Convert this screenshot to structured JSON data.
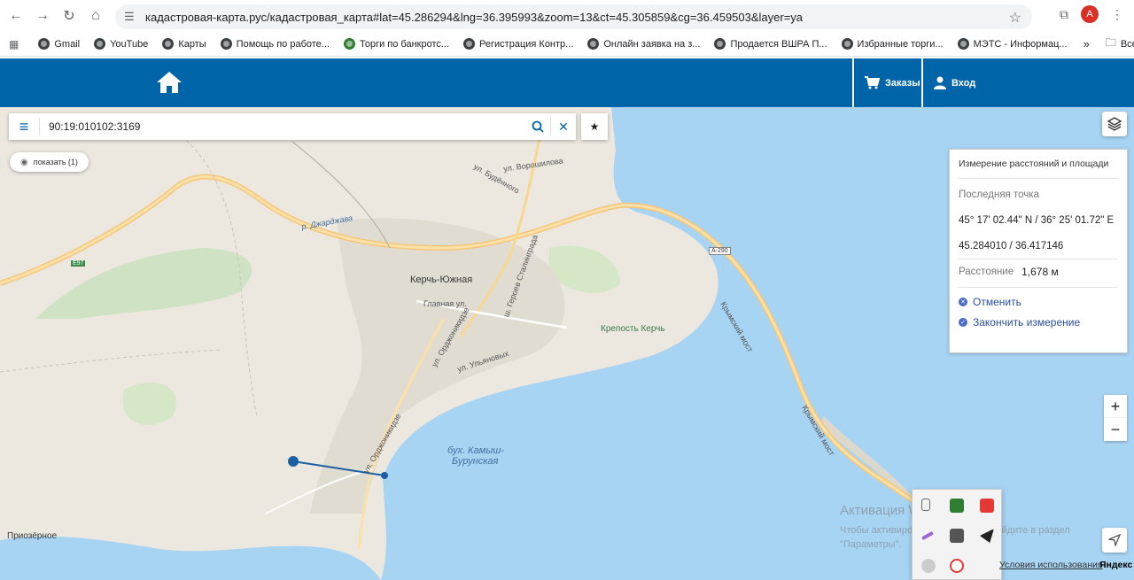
{
  "browser": {
    "url": "кадастровая-карта.рус/кадастровая_карта#lat=45.286294&lng=36.395993&zoom=13&ct=45.305859&cg=36.459503&layer=ya",
    "avatar_letter": "A",
    "bookmarks": [
      "Gmail",
      "YouTube",
      "Карты",
      "Помощь по работе...",
      "Торги по банкротс...",
      "Регистрация Контр...",
      "Онлайн заявка на з...",
      "Продается ВШРА П...",
      "Избранные торги...",
      "МЭТС - Информац..."
    ],
    "more_label": "»",
    "all_bookmarks": "Все закладки"
  },
  "header": {
    "orders_label": "Заказы",
    "login_label": "Вход",
    "color": "#0065a8"
  },
  "search": {
    "value": "90:19:010102:3169"
  },
  "show_button": "показать (1)",
  "measure_panel": {
    "title": "Измерение расстояний и площади",
    "last_point_label": "Последняя точка",
    "dms": "45° 17' 02.44\" N / 36° 25' 01.72\" E",
    "decimal": "45.284010 / 36.417146",
    "distance_label": "Расстояние",
    "distance_value": "1,678 м",
    "cancel_label": "Отменить",
    "finish_label": "Закончить измерение"
  },
  "zoom": {
    "in": "+",
    "out": "−"
  },
  "map_labels": {
    "kerch_south": "Керчь-Южная",
    "fortress": "Крепость Керчь",
    "bay": "бух. Камыш-",
    "bay2": "Бурунская",
    "prioz": "Приозёрное",
    "road_e97": "E97",
    "road_a290": "A-290",
    "crimean_bridge": "Крымский мост",
    "crimean_bridge2": "Крымский мост",
    "river": "р. Джарджава",
    "main_st": "Главная ул.",
    "ord_st": "ул. Орджоникидзе",
    "ord_st2": "ул. Орджоникидзе",
    "ulyan_st": "ул. Ульяновых",
    "voroshilov": "ул. Ворошилова",
    "budenny": "ул. Будённого",
    "heroes": "ш. Героев Сталинграда"
  },
  "watermark": {
    "line1": "Активация Windows",
    "line2": "Чтобы активировать Windows, перейдите в раздел",
    "line3": "\"Параметры\"."
  },
  "footer": {
    "terms": "Условия использования",
    "yandex": "Яндекс"
  }
}
